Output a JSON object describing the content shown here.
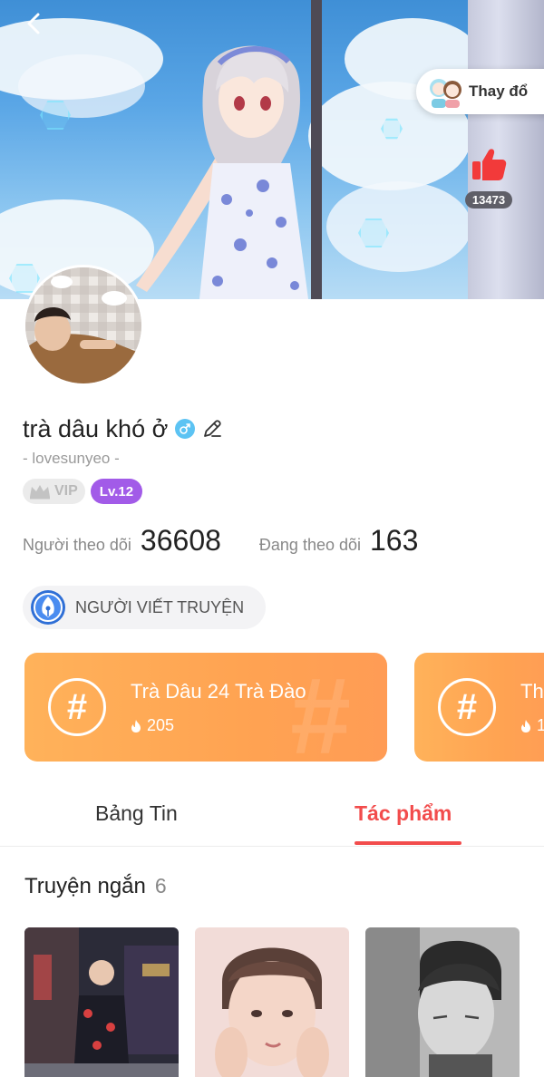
{
  "header": {
    "change_label": "Thay đổ",
    "like_count": "13473"
  },
  "profile": {
    "name": "trà dâu khó ở",
    "handle": "- lovesunyeo -",
    "vip_label": "VIP",
    "level_label": "Lv.12",
    "followers_label": "Người theo dõi",
    "followers_count": "36608",
    "following_label": "Đang theo dõi",
    "following_count": "163",
    "role_label": "NGƯỜI VIẾT TRUYỆN"
  },
  "topics": [
    {
      "title": "Trà Dâu 24 Trà Đào",
      "count": "205"
    },
    {
      "title": "Th",
      "count": "1"
    }
  ],
  "tabs": [
    {
      "label": "Bảng Tin",
      "active": false
    },
    {
      "label": "Tác phẩm",
      "active": true
    }
  ],
  "section": {
    "title": "Truyện ngắn",
    "count": "6"
  },
  "colors": {
    "accent_red": "#f24c4c",
    "level_purple": "#a25be8",
    "topic_orange": "#ffa352",
    "gender_blue": "#5cc3f3"
  }
}
